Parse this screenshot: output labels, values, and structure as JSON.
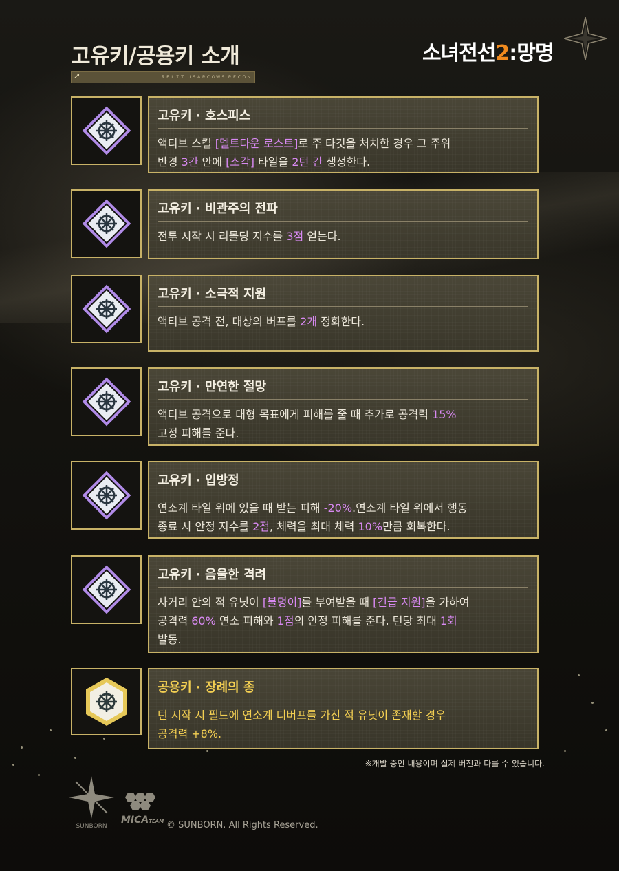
{
  "header": {
    "title": "고유키/공용키 소개",
    "title_bar_text": "ＲＥＬＩＴ ＵＳＡＲＣＯＷＳ ＲＥＣＯＮ",
    "logo": {
      "part1": "소녀전선",
      "part2": "2",
      "part3": ":망명",
      "accent_color": "#f08a1e"
    }
  },
  "cards": [
    {
      "name": "고유키 · 호스피스",
      "icon": "hospice-key-icon",
      "desc": [
        {
          "t": "액티브 스킬 "
        },
        {
          "t": "[멜트다운 로스트]",
          "hl": true
        },
        {
          "t": "로 주 타깃을 처치한 경우 그 주위"
        },
        {
          "br": true
        },
        {
          "t": "반경 "
        },
        {
          "t": "3칸",
          "hl": true
        },
        {
          "t": " 안에 "
        },
        {
          "t": "[소각]",
          "hl": true
        },
        {
          "t": " 타일을 "
        },
        {
          "t": "2턴 간",
          "hl": true
        },
        {
          "t": " 생성한다."
        }
      ]
    },
    {
      "name": "고유키 · 비관주의 전파",
      "icon": "pessimism-key-icon",
      "desc": [
        {
          "t": "전투 시작 시 리몰딩 지수를 "
        },
        {
          "t": "3점",
          "hl": true
        },
        {
          "t": " 얻는다."
        }
      ]
    },
    {
      "name": "고유키 · 소극적 지원",
      "icon": "passive-support-key-icon",
      "desc": [
        {
          "t": "액티브 공격 전, 대상의 버프를 "
        },
        {
          "t": "2개",
          "hl": true
        },
        {
          "t": " 정화한다."
        }
      ]
    },
    {
      "name": "고유키 · 만연한 절망",
      "icon": "despair-key-icon",
      "desc": [
        {
          "t": "액티브 공격으로 대형 목표에게 피해를 줄 때 추가로 공격력 "
        },
        {
          "t": "15%",
          "hl": true
        },
        {
          "br": true
        },
        {
          "t": "고정 피해를 준다."
        }
      ]
    },
    {
      "name": "고유키 · 입방정",
      "icon": "loose-lips-key-icon",
      "desc": [
        {
          "t": "연소계 타일 위에 있을 때 받는 피해 "
        },
        {
          "t": "-20%",
          "hl": true
        },
        {
          "t": ".연소계 타일 위에서 행동"
        },
        {
          "br": true
        },
        {
          "t": "종료 시 안정 지수를 "
        },
        {
          "t": "2점",
          "hl": true
        },
        {
          "t": ", 체력을 최대 체력 "
        },
        {
          "t": "10%",
          "hl": true
        },
        {
          "t": "만큼 회복한다."
        }
      ]
    },
    {
      "name": "고유키 · 음울한 격려",
      "icon": "gloomy-encouragement-key-icon",
      "desc": [
        {
          "t": "사거리 안의 적 유닛이 "
        },
        {
          "t": "[불덩이]",
          "hl": true
        },
        {
          "t": "를 부여받을 때 "
        },
        {
          "t": "[긴급 지원]",
          "hl": true
        },
        {
          "t": "을 가하여"
        },
        {
          "br": true
        },
        {
          "t": "공격력 "
        },
        {
          "t": "60%",
          "hl": true
        },
        {
          "t": " 연소 피해와 "
        },
        {
          "t": "1점",
          "hl": true
        },
        {
          "t": "의 안정 피해를 준다. 턴당 최대 "
        },
        {
          "t": "1회",
          "hl": true
        },
        {
          "br": true
        },
        {
          "t": "발동."
        }
      ]
    },
    {
      "name": "공용키 · 장례의 종",
      "icon": "funeral-bell-key-icon",
      "gold": true,
      "desc": [
        {
          "t": "턴 시작 시 필드에 연소계 디버프를 가진 적 유닛이 존재할 경우"
        },
        {
          "br": true
        },
        {
          "t": "공격력 +8%."
        }
      ]
    }
  ],
  "footer": {
    "note": "※개발 중인 내용이며 실제 버전과 다를 수 있습니다.",
    "sunborn": "SUNBORN",
    "mica": "MICA",
    "mica_small": "TEAM",
    "copyright": "© SUNBORN. All Rights Reserved."
  },
  "colors": {
    "highlight": "#d889f2",
    "gold_text": "#f3cf52",
    "border": "#c8b267"
  }
}
